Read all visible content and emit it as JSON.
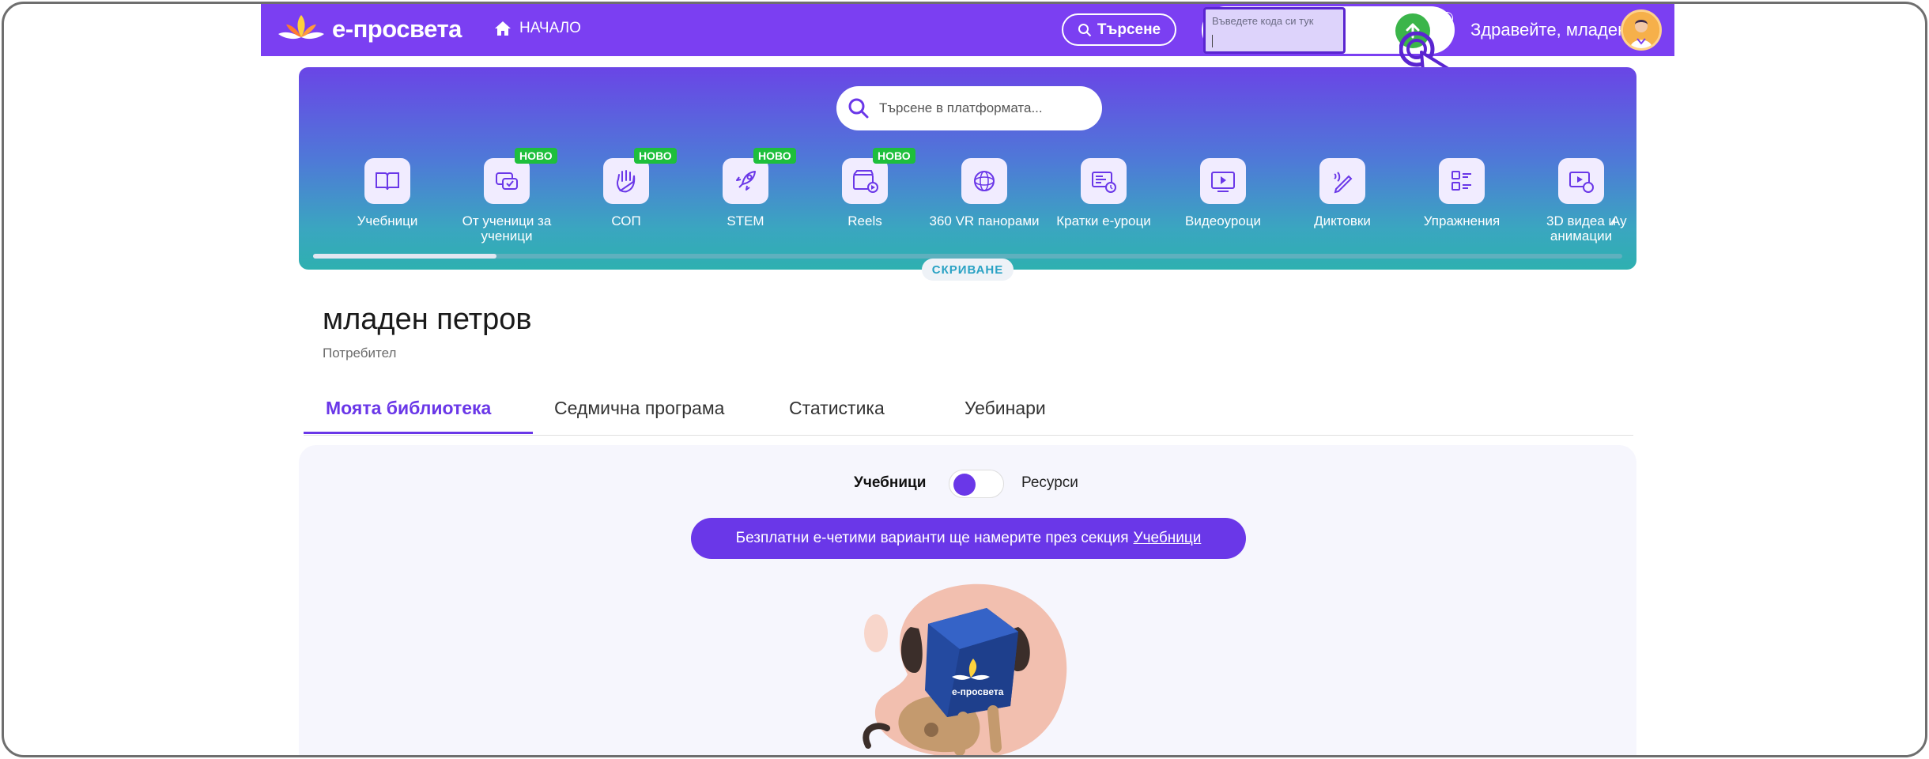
{
  "header": {
    "logo_text": "е-просвета",
    "home_label": "НАЧАЛО",
    "search_label": "Търсене",
    "command_placeholder": "Въведете кода си тук",
    "greeting": "Здравейте, младен",
    "info_glyph": "i"
  },
  "platform_search": {
    "placeholder": "Търсене в платформата..."
  },
  "categories": [
    {
      "label": "Учебници",
      "icon": "book-icon"
    },
    {
      "label": "От ученици за ученици",
      "icon": "chat-icon",
      "badge": "НОВО"
    },
    {
      "label": "СОП",
      "icon": "hand-icon",
      "badge": "НОВО"
    },
    {
      "label": "STEM",
      "icon": "rocket-icon",
      "badge": "НОВО"
    },
    {
      "label": "Reels",
      "icon": "reels-icon",
      "badge": "НОВО"
    },
    {
      "label": "360 VR панорами",
      "icon": "vr-icon"
    },
    {
      "label": "Кратки е-уроци",
      "icon": "lesson-icon"
    },
    {
      "label": "Видеоуроци",
      "icon": "video-icon"
    },
    {
      "label": "Диктовки",
      "icon": "dictation-icon"
    },
    {
      "label": "Упражнения",
      "icon": "exercise-icon"
    },
    {
      "label": "3D видеа и анимации",
      "icon": "3d-video-icon"
    },
    {
      "label": "Ау",
      "icon": "audio-icon"
    }
  ],
  "hide_label": "СКРИВАНЕ",
  "profile": {
    "name": "младен петров",
    "role": "Потребител"
  },
  "tabs": [
    {
      "label": "Моята библиотека",
      "active": true
    },
    {
      "label": "Седмична програма"
    },
    {
      "label": "Статистика"
    },
    {
      "label": "Уебинари"
    }
  ],
  "library": {
    "toggle_left": "Учебници",
    "toggle_right": "Ресурси",
    "notice_text": "Безплатни е-четими варианти ще намерите през секция",
    "notice_link": "Учебници",
    "box_logo": "е-просвета"
  },
  "colors": {
    "brand": "#7b3ff2",
    "accent": "#6a37e8",
    "badge": "#1ebf3c",
    "send": "#3bb54a"
  }
}
